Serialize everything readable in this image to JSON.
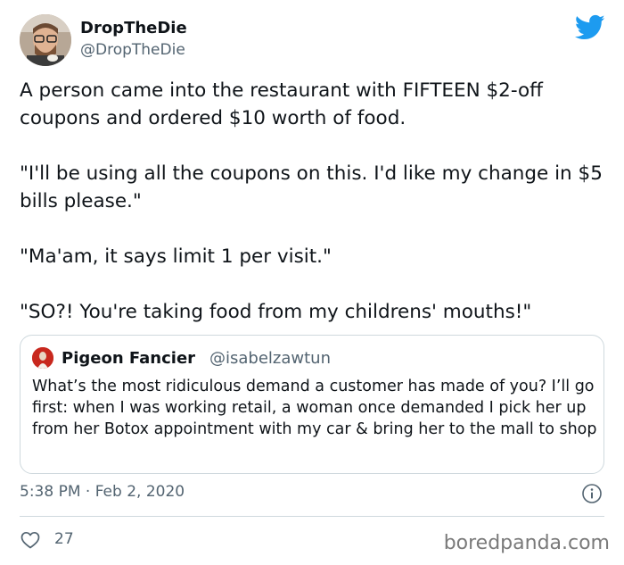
{
  "author": {
    "display_name": "DropTheDie",
    "handle": "@DropTheDie"
  },
  "tweet": {
    "paragraphs": [
      "A person came into the restaurant with FIFTEEN $2-off coupons and ordered $10 worth of food.",
      "\"I'll be using all the coupons on this. I'd like my change in $5 bills please.\"",
      "\"Ma'am, it says limit 1 per visit.\"",
      "\"SO?! You're taking food from my childrens' mouths!\""
    ],
    "timestamp": "5:38 PM · Feb 2, 2020",
    "like_count": "27"
  },
  "quoted_tweet": {
    "display_name": "Pigeon Fancier",
    "handle": "@isabelzawtun",
    "text": "What’s the most ridiculous demand a customer has made of you? I’ll go first: when I was working retail, a woman once demanded I pick her up from her Botox appointment with my car & bring her to the mall to shop"
  },
  "watermark": "boredpanda.com",
  "colors": {
    "twitter_blue": "#1d9bf0",
    "secondary_text": "#536471",
    "border": "#cfd9de"
  },
  "icons": [
    "twitter-bird-icon",
    "info-icon",
    "heart-icon"
  ]
}
